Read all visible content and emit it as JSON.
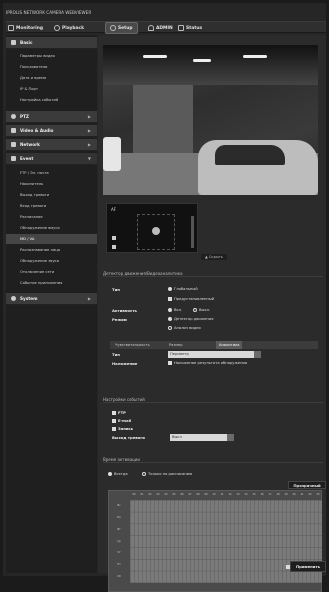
{
  "brand": "IPROLIS NETWORK CAMERA WEBVIEWER",
  "topnav": {
    "monitoring": "Monitoring",
    "playback": "Playback",
    "setup": "Setup",
    "admin": "ADMIN",
    "status": "Status"
  },
  "sidebar": {
    "basic": "Basic",
    "basic_items": [
      "Параметры видео",
      "Пользователи",
      "Дата и время",
      "IP & Порт",
      "Настройка событий"
    ],
    "ptz": "PTZ",
    "video_audio": "Video & Audio",
    "network": "Network",
    "event": "Event",
    "event_items": [
      "FTP / Эл. почта",
      "Накопитель",
      "Выход тревоги",
      "Вход тревоги",
      "Расписание",
      "Обнаружение вмуса",
      "MD / VA",
      "Распознавание лица",
      "Обнаружение звука",
      "Отключение сети",
      "Событие приложения"
    ],
    "system": "System"
  },
  "ptz": {
    "af": "AF",
    "hide": "Скрыть"
  },
  "motion": {
    "section": "Детектор движения/Видеоаналитика",
    "type_label": "Тип",
    "type_opt1": "Глобальный",
    "type_opt2": "Предустановленный",
    "activity_label": "Активность",
    "activity_on": "Вкл.",
    "activity_off": "Выкл.",
    "mode_label": "Режим",
    "mode_opt1": "Детектор движения",
    "mode_opt2": "Анализ видео",
    "tabs": [
      "Чувствительность",
      "Размер",
      "Аналитика"
    ],
    "sub_type_label": "Тип",
    "sub_type_value": "Периметр",
    "overlay_label": "Наложение",
    "overlay_value": "Наложение результата обнаружения"
  },
  "event_settings": {
    "section": "Настройки событий",
    "ftp": "FTP",
    "email": "E-mail",
    "record": "Запись",
    "alarm_out_label": "Выход тревоги",
    "alarm_out_value": "Выкл"
  },
  "schedule": {
    "section": "Время активации",
    "always": "Всегда",
    "only_schedule": "Только по расписанию",
    "transparent_btn": "Прозрачный",
    "hours": [
      "00",
      "01",
      "02",
      "03",
      "04",
      "05",
      "06",
      "07",
      "08",
      "09",
      "10",
      "11",
      "12",
      "13",
      "14",
      "15",
      "16",
      "17",
      "18",
      "19",
      "20",
      "21",
      "22",
      "23"
    ],
    "days": [
      "Вс",
      "Пн",
      "Вт",
      "Ср",
      "Чт",
      "Пт",
      "Сб"
    ],
    "start_label": "начать",
    "end_label": "ко"
  },
  "apply": "Применить"
}
